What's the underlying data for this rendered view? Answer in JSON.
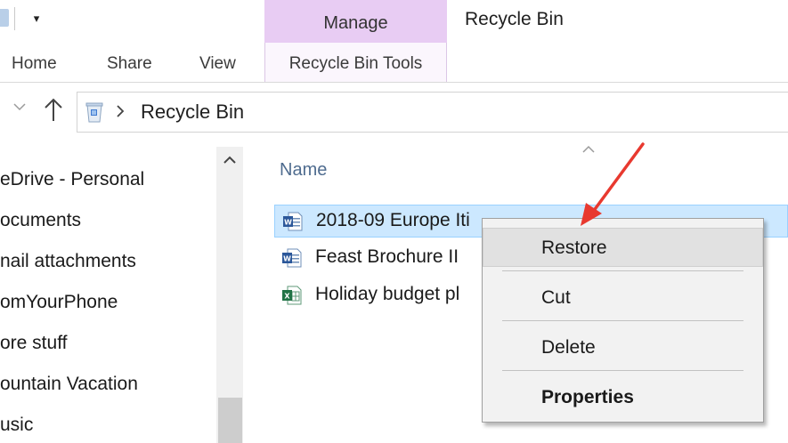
{
  "window": {
    "title": "Recycle Bin"
  },
  "ribbon": {
    "contextual_group": "Manage",
    "contextual_tab": "Recycle Bin Tools",
    "tabs": [
      "Home",
      "Share",
      "View"
    ],
    "qat_dropdown_glyph": "▾"
  },
  "address_bar": {
    "location": "Recycle Bin",
    "icon": "recycle-bin-icon"
  },
  "nav_pane": {
    "items": [
      "eDrive - Personal",
      "ocuments",
      "nail attachments",
      "omYourPhone",
      "ore stuff",
      "ountain Vacation",
      "usic"
    ]
  },
  "file_list": {
    "column_name": "Name",
    "files": [
      {
        "name": "2018-09 Europe Iti",
        "type": "word",
        "selected": true
      },
      {
        "name": "Feast Brochure II",
        "type": "word",
        "selected": false
      },
      {
        "name": "Holiday budget pl",
        "type": "excel",
        "selected": false
      }
    ]
  },
  "context_menu": {
    "items": [
      "Restore",
      "Cut",
      "Delete",
      "Properties"
    ]
  },
  "colors": {
    "manage_tab": "#e8ccf3",
    "selection": "#cce8ff",
    "menu_background": "#f2f2f2",
    "annotation_arrow": "#e8392f",
    "word_icon": "#2b579a",
    "excel_icon": "#217346"
  }
}
